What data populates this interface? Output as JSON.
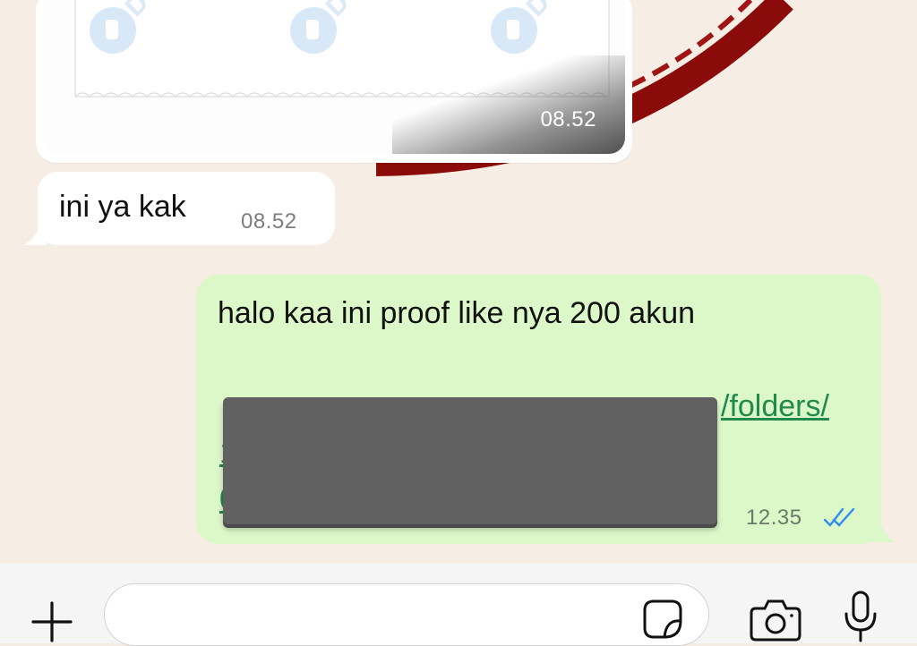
{
  "messages": {
    "image": {
      "time": "08.52"
    },
    "incoming": {
      "text": "ini ya kak",
      "time": "08.52"
    },
    "outgoing": {
      "text": "halo kaa ini proof like nya 200 akun",
      "link_visible": "/folders/",
      "link_frag_2": "1",
      "link_frag_3": "0",
      "time": "12.35",
      "status": "read"
    }
  },
  "composer": {
    "placeholder": ""
  },
  "icons": {
    "attach": "plus-icon",
    "sticker": "sticker-icon",
    "camera": "camera-icon",
    "mic": "microphone-icon",
    "status": "double-check-icon"
  },
  "colors": {
    "outgoing_bubble": "#dcf8c8",
    "incoming_bubble": "#ffffff",
    "link": "#1f8a4c",
    "read_ticks": "#2f8cf0",
    "chat_background": "#f6eee5"
  }
}
